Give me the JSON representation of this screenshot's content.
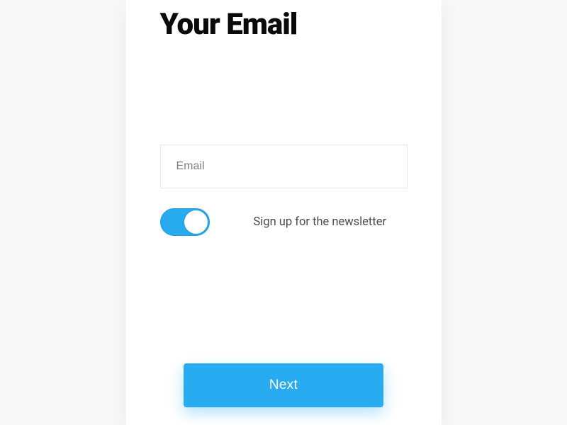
{
  "heading": "Your Email",
  "email": {
    "value": "",
    "placeholder": "Email"
  },
  "newsletter": {
    "label": "Sign up for the newsletter",
    "on": true
  },
  "buttons": {
    "next": "Next"
  },
  "colors": {
    "accent": "#28abf0"
  }
}
